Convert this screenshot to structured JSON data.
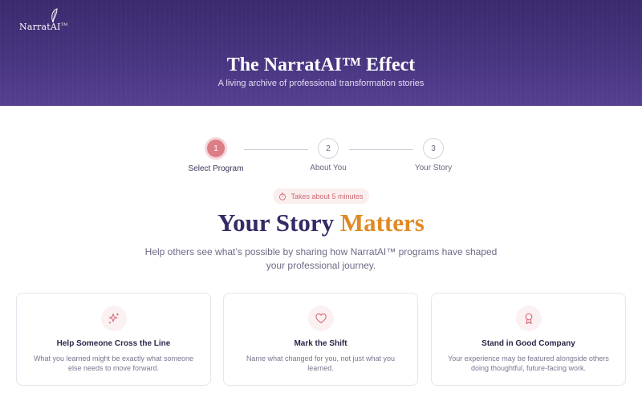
{
  "brand": {
    "logo_text": "NarratAI",
    "logo_tm": "TM"
  },
  "hero": {
    "title": "The NarratAI™ Effect",
    "subtitle": "A living archive of professional transformation stories"
  },
  "stepper": {
    "steps": [
      {
        "number": "1",
        "label": "Select Program",
        "active": true
      },
      {
        "number": "2",
        "label": "About You",
        "active": false
      },
      {
        "number": "3",
        "label": "Your Story",
        "active": false
      }
    ]
  },
  "time_estimate": "Takes about 5 minutes",
  "headline": {
    "part1": "Your Story",
    "part2": "Matters"
  },
  "description": "Help others see what’s possible by sharing how NarratAI™ programs have shaped your professional journey.",
  "cards": [
    {
      "icon": "sparkle-icon",
      "title": "Help Someone Cross the Line",
      "text": "What you learned might be exactly what someone else needs to move forward."
    },
    {
      "icon": "heart-icon",
      "title": "Mark the Shift",
      "text": "Name what changed for you, not just what you learned."
    },
    {
      "icon": "award-icon",
      "title": "Stand in Good Company",
      "text": "Your experience may be featured alongside others doing thoughtful, future-facing work."
    }
  ],
  "colors": {
    "hero_bg": "#47357f",
    "step_active": "#dd7e86",
    "title": "#332b66",
    "accent": "#e08a25",
    "icon_color": "#d9727b"
  }
}
